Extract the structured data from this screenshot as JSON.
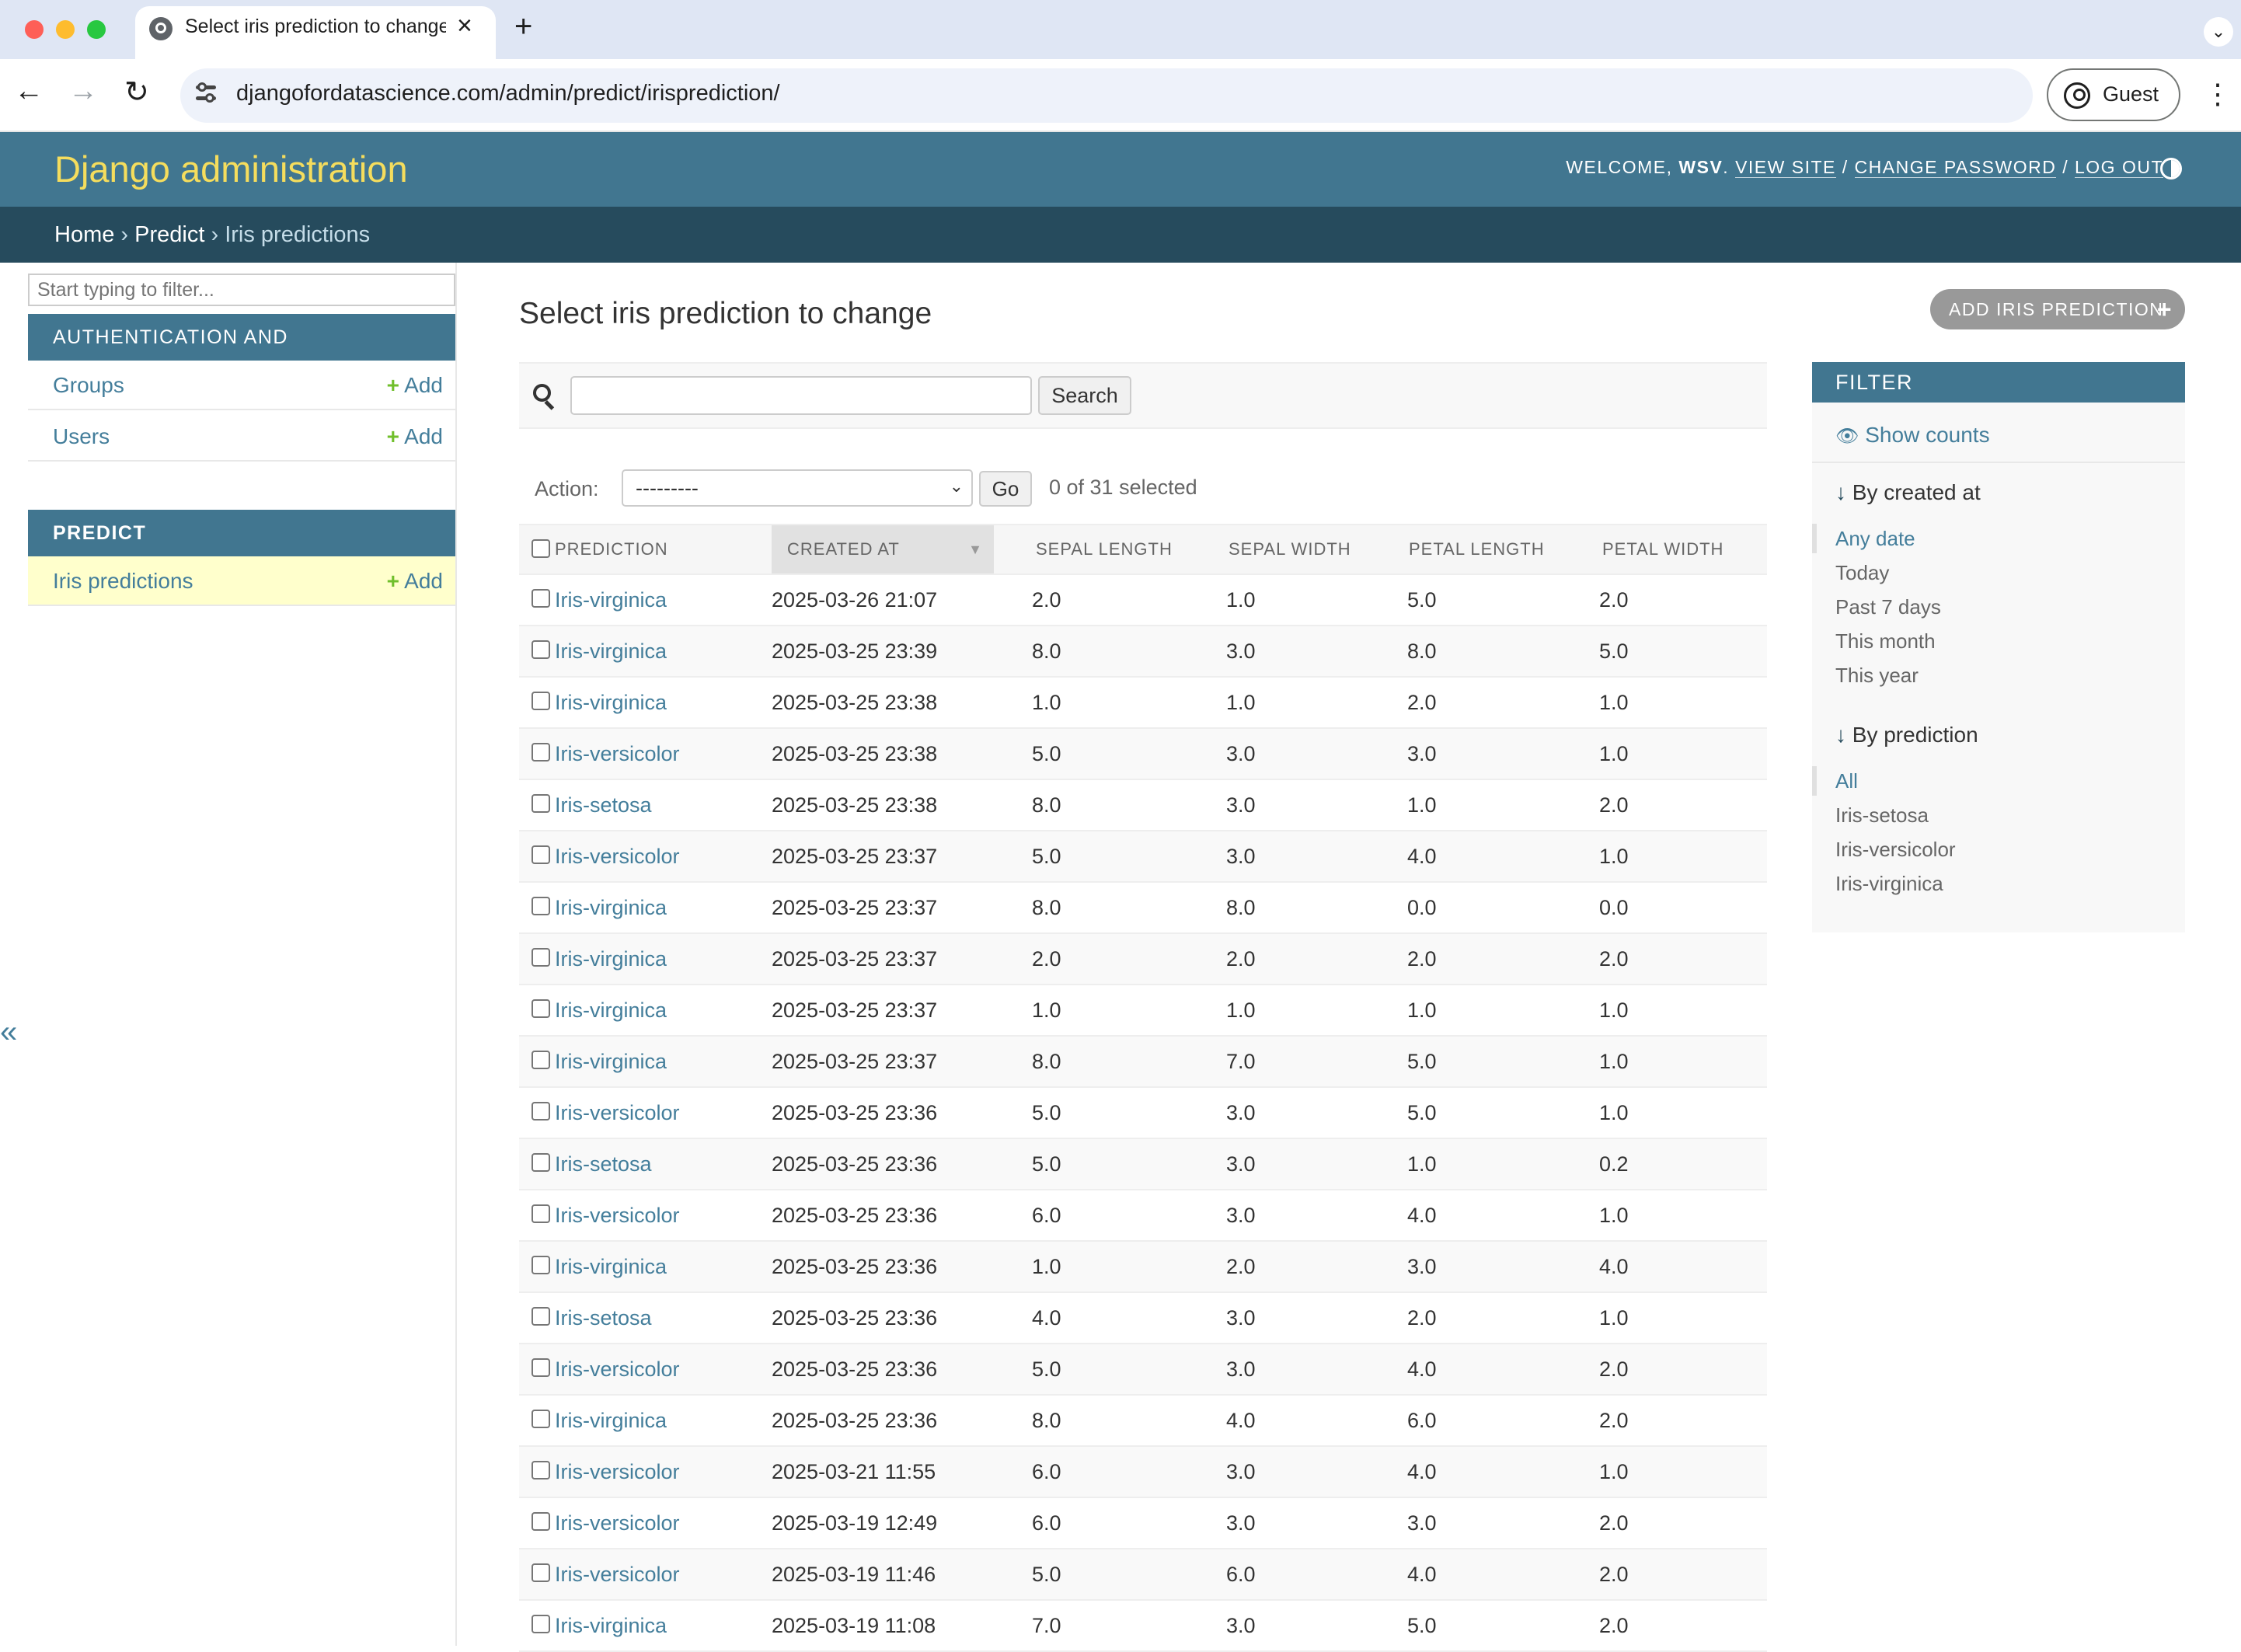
{
  "browser": {
    "tab_title": "Select iris prediction to change | Django site admin",
    "url": "djangofordatascience.com/admin/predict/irisprediction/",
    "profile_label": "Guest"
  },
  "header": {
    "site_name": "Django administration",
    "welcome": "WELCOME,",
    "username": "WSV",
    "view_site": "VIEW SITE",
    "change_password": "CHANGE PASSWORD",
    "log_out": "LOG OUT"
  },
  "breadcrumbs": {
    "home": "Home",
    "app": "Predict",
    "current": "Iris predictions",
    "sep": "›"
  },
  "sidebar": {
    "filter_placeholder": "Start typing to filter...",
    "modules": [
      {
        "caption": "AUTHENTICATION AND AUTHORIZATION",
        "items": [
          {
            "name": "Groups",
            "add": "Add"
          },
          {
            "name": "Users",
            "add": "Add"
          }
        ]
      },
      {
        "caption": "PREDICT",
        "items": [
          {
            "name": "Iris predictions",
            "add": "Add"
          }
        ]
      }
    ],
    "collapse_glyph": "«"
  },
  "main": {
    "title": "Select iris prediction to change",
    "add_button": "ADD IRIS PREDICTION",
    "search_button": "Search",
    "search_value": "",
    "action_label": "Action:",
    "action_selected": "---------",
    "go_button": "Go",
    "selection_counter": "0 of 31 selected",
    "columns": [
      "PREDICTION",
      "CREATED AT",
      "SEPAL LENGTH",
      "SEPAL WIDTH",
      "PETAL LENGTH",
      "PETAL WIDTH"
    ],
    "rows": [
      [
        "Iris-virginica",
        "2025-03-26 21:07",
        "2.0",
        "1.0",
        "5.0",
        "2.0"
      ],
      [
        "Iris-virginica",
        "2025-03-25 23:39",
        "8.0",
        "3.0",
        "8.0",
        "5.0"
      ],
      [
        "Iris-virginica",
        "2025-03-25 23:38",
        "1.0",
        "1.0",
        "2.0",
        "1.0"
      ],
      [
        "Iris-versicolor",
        "2025-03-25 23:38",
        "5.0",
        "3.0",
        "3.0",
        "1.0"
      ],
      [
        "Iris-setosa",
        "2025-03-25 23:38",
        "8.0",
        "3.0",
        "1.0",
        "2.0"
      ],
      [
        "Iris-versicolor",
        "2025-03-25 23:37",
        "5.0",
        "3.0",
        "4.0",
        "1.0"
      ],
      [
        "Iris-virginica",
        "2025-03-25 23:37",
        "8.0",
        "8.0",
        "0.0",
        "0.0"
      ],
      [
        "Iris-virginica",
        "2025-03-25 23:37",
        "2.0",
        "2.0",
        "2.0",
        "2.0"
      ],
      [
        "Iris-virginica",
        "2025-03-25 23:37",
        "1.0",
        "1.0",
        "1.0",
        "1.0"
      ],
      [
        "Iris-virginica",
        "2025-03-25 23:37",
        "8.0",
        "7.0",
        "5.0",
        "1.0"
      ],
      [
        "Iris-versicolor",
        "2025-03-25 23:36",
        "5.0",
        "3.0",
        "5.0",
        "1.0"
      ],
      [
        "Iris-setosa",
        "2025-03-25 23:36",
        "5.0",
        "3.0",
        "1.0",
        "0.2"
      ],
      [
        "Iris-versicolor",
        "2025-03-25 23:36",
        "6.0",
        "3.0",
        "4.0",
        "1.0"
      ],
      [
        "Iris-virginica",
        "2025-03-25 23:36",
        "1.0",
        "2.0",
        "3.0",
        "4.0"
      ],
      [
        "Iris-setosa",
        "2025-03-25 23:36",
        "4.0",
        "3.0",
        "2.0",
        "1.0"
      ],
      [
        "Iris-versicolor",
        "2025-03-25 23:36",
        "5.0",
        "3.0",
        "4.0",
        "2.0"
      ],
      [
        "Iris-virginica",
        "2025-03-25 23:36",
        "8.0",
        "4.0",
        "6.0",
        "2.0"
      ],
      [
        "Iris-versicolor",
        "2025-03-21 11:55",
        "6.0",
        "3.0",
        "4.0",
        "1.0"
      ],
      [
        "Iris-versicolor",
        "2025-03-19 12:49",
        "6.0",
        "3.0",
        "3.0",
        "2.0"
      ],
      [
        "Iris-versicolor",
        "2025-03-19 11:46",
        "5.0",
        "6.0",
        "4.0",
        "2.0"
      ],
      [
        "Iris-virginica",
        "2025-03-19 11:08",
        "7.0",
        "3.0",
        "5.0",
        "2.0"
      ]
    ]
  },
  "filter": {
    "caption": "FILTER",
    "show_counts": "Show counts",
    "groups": [
      {
        "heading": "By created at",
        "options": [
          "Any date",
          "Today",
          "Past 7 days",
          "This month",
          "This year"
        ],
        "selected": "Any date"
      },
      {
        "heading": "By prediction",
        "options": [
          "All",
          "Iris-setosa",
          "Iris-versicolor",
          "Iris-virginica"
        ],
        "selected": "All"
      }
    ]
  }
}
